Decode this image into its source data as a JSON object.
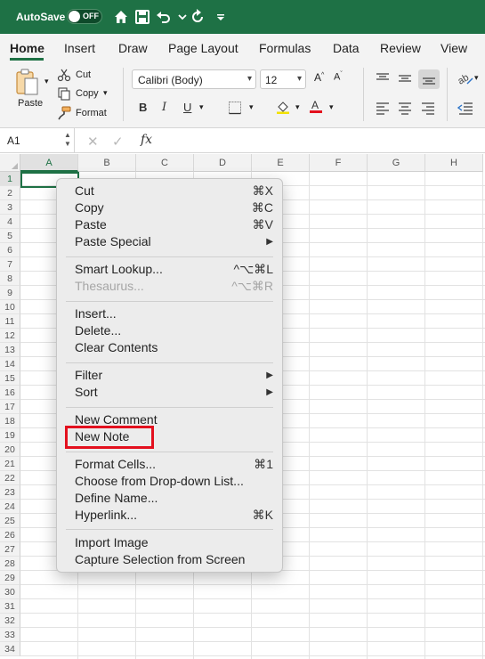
{
  "titlebar": {
    "autosave_label": "AutoSave",
    "toggle_state": "OFF",
    "bg_color": "#1e7145"
  },
  "tabs": [
    "Home",
    "Insert",
    "Draw",
    "Page Layout",
    "Formulas",
    "Data",
    "Review",
    "View"
  ],
  "ribbon": {
    "paste": "Paste",
    "cut": "Cut",
    "copy": "Copy",
    "format": "Format",
    "font_name": "Calibri (Body)",
    "font_size": "12",
    "bold": "B",
    "italic": "I",
    "underline": "U"
  },
  "formula_bar": {
    "name_box": "A1",
    "fx": "fx"
  },
  "columns": [
    "A",
    "B",
    "C",
    "D",
    "E",
    "F",
    "G",
    "H"
  ],
  "rows": [
    "1",
    "2",
    "3",
    "4",
    "5",
    "6",
    "7",
    "8",
    "9",
    "10",
    "11",
    "12",
    "13",
    "14",
    "15",
    "16",
    "17",
    "18",
    "19",
    "20",
    "21",
    "22",
    "23",
    "24",
    "25",
    "26",
    "27",
    "28",
    "29",
    "30",
    "31",
    "32",
    "33",
    "34"
  ],
  "context_menu": {
    "items": [
      {
        "label": "Cut",
        "shortcut": "⌘X"
      },
      {
        "label": "Copy",
        "shortcut": "⌘C"
      },
      {
        "label": "Paste",
        "shortcut": "⌘V"
      },
      {
        "label": "Paste Special",
        "shortcut": "▶"
      },
      {
        "label": "Smart Lookup...",
        "shortcut": "^⌥⌘L"
      },
      {
        "label": "Thesaurus...",
        "shortcut": "^⌥⌘R"
      },
      {
        "label": "Insert...",
        "shortcut": ""
      },
      {
        "label": "Delete...",
        "shortcut": ""
      },
      {
        "label": "Clear Contents",
        "shortcut": ""
      },
      {
        "label": "Filter",
        "shortcut": "▶"
      },
      {
        "label": "Sort",
        "shortcut": "▶"
      },
      {
        "label": "New Comment",
        "shortcut": ""
      },
      {
        "label": "New Note",
        "shortcut": ""
      },
      {
        "label": "Format Cells...",
        "shortcut": "⌘1"
      },
      {
        "label": "Choose from Drop-down List...",
        "shortcut": ""
      },
      {
        "label": "Define Name...",
        "shortcut": ""
      },
      {
        "label": "Hyperlink...",
        "shortcut": "⌘K"
      },
      {
        "label": "Import Image",
        "shortcut": ""
      },
      {
        "label": "Capture Selection from Screen",
        "shortcut": ""
      }
    ]
  },
  "colors": {
    "accent": "#1e7145",
    "highlight_box": "#e3101e"
  }
}
